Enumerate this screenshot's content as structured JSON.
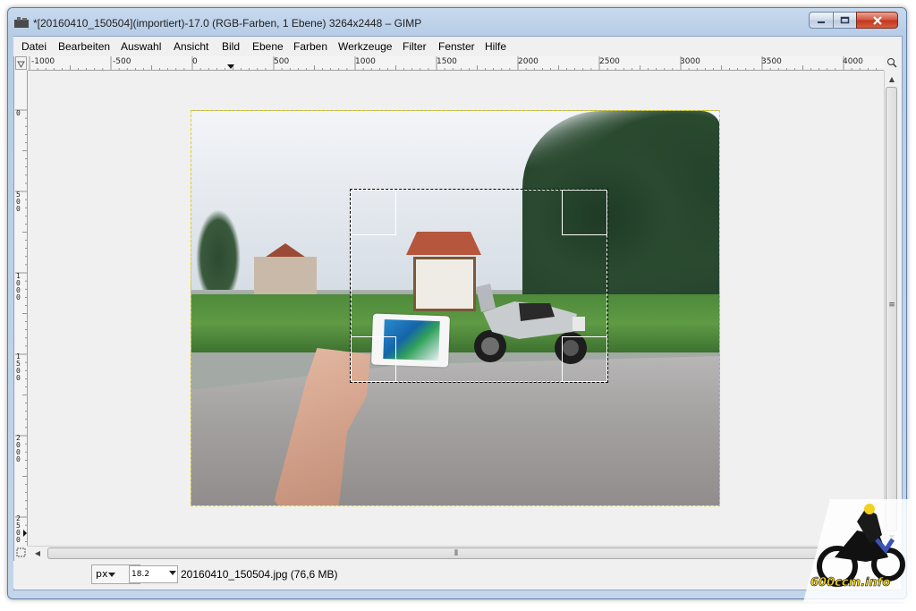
{
  "window": {
    "title": "*[20160410_150504](importiert)-17.0 (RGB-Farben, 1 Ebene) 3264x2448 – GIMP",
    "minimize_icon": "minimize-icon",
    "maximize_icon": "maximize-icon",
    "close_icon": "close-icon"
  },
  "menu": {
    "items": [
      {
        "label": "Datei"
      },
      {
        "label": "Bearbeiten"
      },
      {
        "label": "Auswahl"
      },
      {
        "label": "Ansicht"
      },
      {
        "label": "Bild"
      },
      {
        "label": "Ebene"
      },
      {
        "label": "Farben"
      },
      {
        "label": "Werkzeuge"
      },
      {
        "label": "Filter"
      },
      {
        "label": "Fenster"
      },
      {
        "label": "Hilfe"
      }
    ]
  },
  "rulers": {
    "horizontal_labels": [
      "-1000",
      "-500",
      "0",
      "500",
      "1000",
      "1500",
      "2000",
      "2500",
      "3000",
      "3500",
      "4000"
    ],
    "vertical_labels": [
      "0",
      "500",
      "1000",
      "1500",
      "2000",
      "2500"
    ]
  },
  "statusbar": {
    "unit": "px",
    "zoom": "18.2",
    "file_info": "20160410_150504.jpg (76,6 MB)"
  },
  "colors": {
    "layer_boundary": "#d9d21a",
    "selection": "#000000",
    "close_button": "#c4331b"
  },
  "watermark": {
    "text": "600ccm.info"
  }
}
